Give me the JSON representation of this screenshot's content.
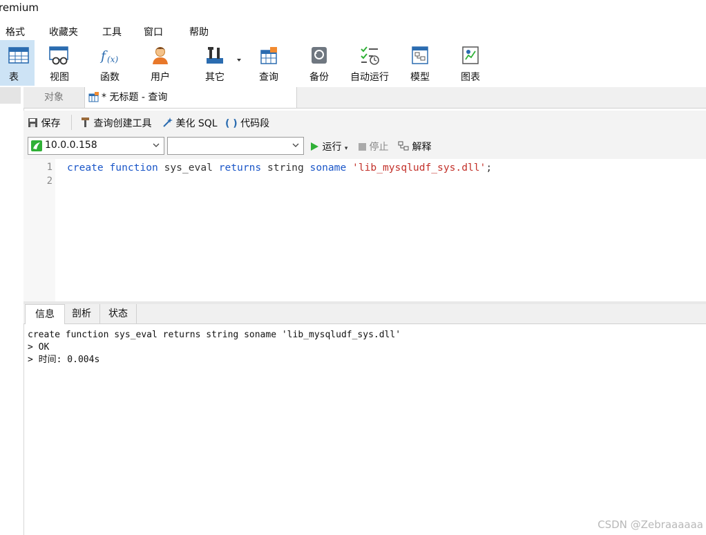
{
  "app": {
    "title": "remium"
  },
  "menu": [
    "格式",
    "收藏夹",
    "工具",
    "窗口",
    "帮助"
  ],
  "toolbar": [
    {
      "label": "表",
      "icon": "table-icon",
      "active": true
    },
    {
      "label": "视图",
      "icon": "view-icon"
    },
    {
      "label": "函数",
      "icon": "function-icon"
    },
    {
      "label": "用户",
      "icon": "user-icon"
    },
    {
      "label": "其它",
      "icon": "tools-icon"
    },
    {
      "label": "查询",
      "icon": "query-icon"
    },
    {
      "label": "备份",
      "icon": "backup-icon"
    },
    {
      "label": "自动运行",
      "icon": "autorun-icon"
    },
    {
      "label": "模型",
      "icon": "model-icon"
    },
    {
      "label": "图表",
      "icon": "chart-icon"
    }
  ],
  "tabs": {
    "objects": "对象",
    "query": "* 无标题 - 查询"
  },
  "query_toolbar": {
    "save": "保存",
    "builder": "查询创建工具",
    "beautify": "美化 SQL",
    "snippet": "代码段"
  },
  "connection": {
    "server": "10.0.0.158",
    "database": ""
  },
  "actions": {
    "run": "运行",
    "stop": "停止",
    "explain": "解释"
  },
  "editor": {
    "line_numbers": [
      "1",
      "2"
    ],
    "code": {
      "kw1": "create",
      "kw2": "function",
      "name": "sys_eval",
      "kw3": "returns",
      "type": "string",
      "kw4": "soname",
      "lib": "'lib_mysqludf_sys.dll'",
      "end": ";"
    }
  },
  "result_tabs": [
    "信息",
    "剖析",
    "状态"
  ],
  "output_lines": [
    "create function sys_eval returns string soname 'lib_mysqludf_sys.dll'",
    "> OK",
    "> 时间: 0.004s"
  ],
  "watermark": "CSDN @Zebraaaaaa",
  "colors": {
    "accent": "#cde3f5",
    "keyword": "#1a56c8",
    "string": "#c3312a",
    "run": "#2fb036"
  }
}
